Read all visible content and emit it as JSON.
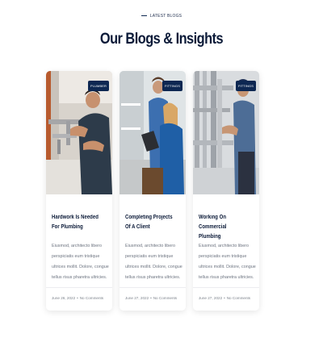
{
  "section": {
    "eyebrow": "LATEST BLOGS",
    "heading": "Our Blogs & Insights"
  },
  "cards": [
    {
      "tag": "PLUMBER",
      "image": "plumber-fixing-sink-pipes",
      "title": "Hardwork Is Needed For Plumbing",
      "excerpt": "Eiusmod, architecto libero perspiciatis eum tristique ultrices mollit. Dolore, congue tellus risus pharetra ultricies.",
      "date": "June 26, 2022",
      "comments": "No Comments"
    },
    {
      "tag": "FITTINGS",
      "image": "plumber-with-client-tablet",
      "title": "Completing Projects Of A Client",
      "excerpt": "Eiusmod, architecto libero perspiciatis eum tristique ultrices mollit. Dolore, congue tellus risus pharetra ultricies.",
      "date": "June 27, 2022",
      "comments": "No Comments"
    },
    {
      "tag": "FITTINGS",
      "image": "worker-inspecting-industrial-pipes",
      "title": "Working On Commercial Plumbing",
      "excerpt": "Eiusmod, architecto libero perspiciatis eum tristique ultrices mollit. Dolore, congue tellus risus pharetra ultricies.",
      "date": "June 27, 2022",
      "comments": "No Comments"
    }
  ],
  "colors": {
    "navy": "#0d2752",
    "heading": "#0b1a38",
    "text_muted": "#6d7480"
  }
}
